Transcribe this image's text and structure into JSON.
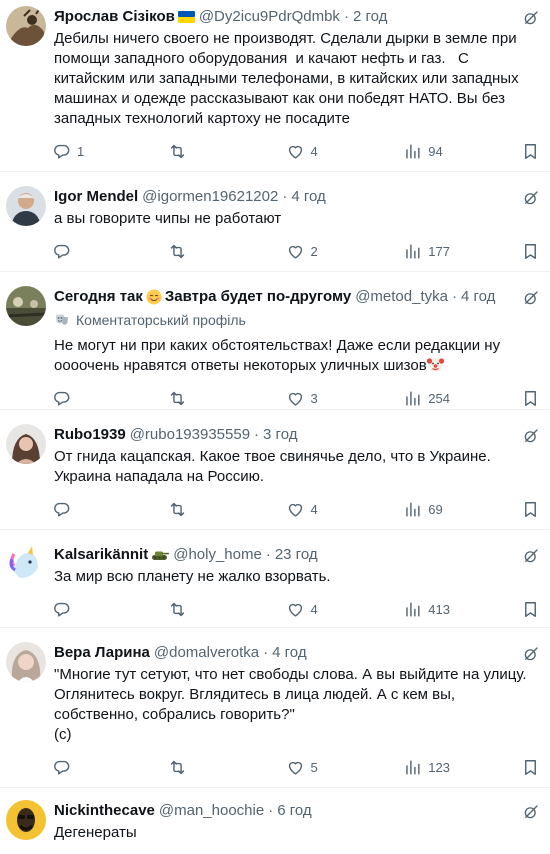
{
  "tweets": [
    {
      "name": "Ярослав Сізіков",
      "emoji": "ukraine-flag",
      "handle": "@Dy2icu9PdrQdmbk",
      "time": "2 год",
      "profile_tag": "",
      "text": "Дебилы ничего своего не производят. Сделали дырки в земле при помощи западного оборудования  и качают нефть и газ.   С китайским или западными телефонами, в китайских или западных  машинах и одежде рассказывают как они победят НАТО. Вы без западных технологий картоху не посадите",
      "replies": "1",
      "retweets": "",
      "likes": "4",
      "views": "94"
    },
    {
      "name": "Igor Mendel",
      "emoji": "",
      "handle": "@igormen19621202",
      "time": "4 год",
      "profile_tag": "",
      "text": "а вы говорите чипы не работают",
      "replies": "",
      "retweets": "",
      "likes": "2",
      "views": "177"
    },
    {
      "name": "Сегодня так",
      "name2": "Завтра будет по-другому",
      "emoji": "relieved-face",
      "handle": "@metod_tyka",
      "time": "4 год",
      "profile_tag": "Коментаторський профіль",
      "text": "Не могут ни при каких обстоятельствах! Даже если редакции ну оооочень нравятся ответы некоторых уличных шизов",
      "text_emoji": "clown-face",
      "replies": "",
      "retweets": "",
      "likes": "3",
      "views": "254"
    },
    {
      "name": "Rubo1939",
      "emoji": "",
      "handle": "@rubo193935559",
      "time": "3 год",
      "profile_tag": "",
      "text": "От гнида кацапская. Какое твое свинячье дело, что в Украине. Украина нападала на Россию.",
      "replies": "",
      "retweets": "",
      "likes": "4",
      "views": "69"
    },
    {
      "name": "Kalsarikännit",
      "emoji": "tank",
      "handle": "@holy_home",
      "time": "23 год",
      "profile_tag": "",
      "text": "За мир всю планету не жалко взорвать.",
      "replies": "",
      "retweets": "",
      "likes": "4",
      "views": "413"
    },
    {
      "name": "Вера Ларина",
      "emoji": "",
      "handle": "@domalverotka",
      "time": "4 год",
      "profile_tag": "",
      "text": "\"Многие тут сетуют, что нет свободы слова. А вы выйдите на улицу. Оглянитесь вокруг. Вглядитесь в лица людей. А с кем вы, собственно, собрались говорить?\"\n(с)",
      "replies": "",
      "retweets": "",
      "likes": "5",
      "views": "123"
    },
    {
      "name": "Nickinthecave",
      "emoji": "",
      "handle": "@man_hoochie",
      "time": "6 год",
      "profile_tag": "",
      "text": "Дегенераты",
      "replies": "",
      "retweets": "",
      "likes": "",
      "views": ""
    }
  ],
  "icons": {
    "reply": "reply-icon",
    "retweet": "retweet-icon",
    "like": "heart-icon",
    "views": "views-icon",
    "bookmark": "bookmark-icon",
    "more": "grok-icon"
  },
  "colors": {
    "text": "#0f1419",
    "muted": "#536471",
    "divider": "#eff3f4"
  }
}
